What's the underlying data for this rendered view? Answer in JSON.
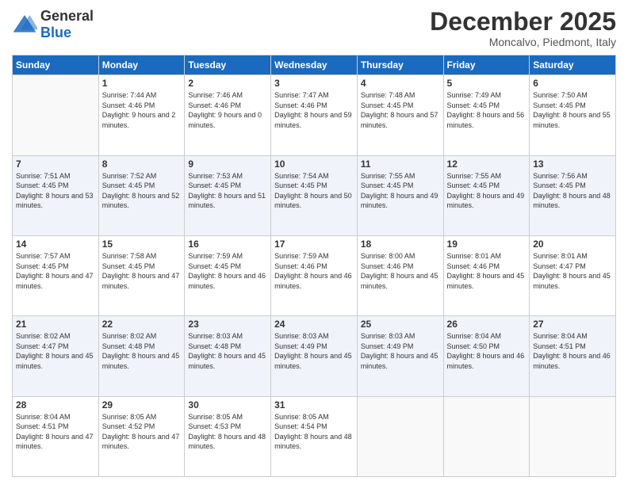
{
  "header": {
    "logo": {
      "general": "General",
      "blue": "Blue"
    },
    "title": "December 2025",
    "subtitle": "Moncalvo, Piedmont, Italy"
  },
  "weekdays": [
    "Sunday",
    "Monday",
    "Tuesday",
    "Wednesday",
    "Thursday",
    "Friday",
    "Saturday"
  ],
  "rows": [
    [
      {
        "day": "",
        "sunrise": "",
        "sunset": "",
        "daylight": ""
      },
      {
        "day": "1",
        "sunrise": "Sunrise: 7:44 AM",
        "sunset": "Sunset: 4:46 PM",
        "daylight": "Daylight: 9 hours and 2 minutes."
      },
      {
        "day": "2",
        "sunrise": "Sunrise: 7:46 AM",
        "sunset": "Sunset: 4:46 PM",
        "daylight": "Daylight: 9 hours and 0 minutes."
      },
      {
        "day": "3",
        "sunrise": "Sunrise: 7:47 AM",
        "sunset": "Sunset: 4:46 PM",
        "daylight": "Daylight: 8 hours and 59 minutes."
      },
      {
        "day": "4",
        "sunrise": "Sunrise: 7:48 AM",
        "sunset": "Sunset: 4:45 PM",
        "daylight": "Daylight: 8 hours and 57 minutes."
      },
      {
        "day": "5",
        "sunrise": "Sunrise: 7:49 AM",
        "sunset": "Sunset: 4:45 PM",
        "daylight": "Daylight: 8 hours and 56 minutes."
      },
      {
        "day": "6",
        "sunrise": "Sunrise: 7:50 AM",
        "sunset": "Sunset: 4:45 PM",
        "daylight": "Daylight: 8 hours and 55 minutes."
      }
    ],
    [
      {
        "day": "7",
        "sunrise": "Sunrise: 7:51 AM",
        "sunset": "Sunset: 4:45 PM",
        "daylight": "Daylight: 8 hours and 53 minutes."
      },
      {
        "day": "8",
        "sunrise": "Sunrise: 7:52 AM",
        "sunset": "Sunset: 4:45 PM",
        "daylight": "Daylight: 8 hours and 52 minutes."
      },
      {
        "day": "9",
        "sunrise": "Sunrise: 7:53 AM",
        "sunset": "Sunset: 4:45 PM",
        "daylight": "Daylight: 8 hours and 51 minutes."
      },
      {
        "day": "10",
        "sunrise": "Sunrise: 7:54 AM",
        "sunset": "Sunset: 4:45 PM",
        "daylight": "Daylight: 8 hours and 50 minutes."
      },
      {
        "day": "11",
        "sunrise": "Sunrise: 7:55 AM",
        "sunset": "Sunset: 4:45 PM",
        "daylight": "Daylight: 8 hours and 49 minutes."
      },
      {
        "day": "12",
        "sunrise": "Sunrise: 7:55 AM",
        "sunset": "Sunset: 4:45 PM",
        "daylight": "Daylight: 8 hours and 49 minutes."
      },
      {
        "day": "13",
        "sunrise": "Sunrise: 7:56 AM",
        "sunset": "Sunset: 4:45 PM",
        "daylight": "Daylight: 8 hours and 48 minutes."
      }
    ],
    [
      {
        "day": "14",
        "sunrise": "Sunrise: 7:57 AM",
        "sunset": "Sunset: 4:45 PM",
        "daylight": "Daylight: 8 hours and 47 minutes."
      },
      {
        "day": "15",
        "sunrise": "Sunrise: 7:58 AM",
        "sunset": "Sunset: 4:45 PM",
        "daylight": "Daylight: 8 hours and 47 minutes."
      },
      {
        "day": "16",
        "sunrise": "Sunrise: 7:59 AM",
        "sunset": "Sunset: 4:45 PM",
        "daylight": "Daylight: 8 hours and 46 minutes."
      },
      {
        "day": "17",
        "sunrise": "Sunrise: 7:59 AM",
        "sunset": "Sunset: 4:46 PM",
        "daylight": "Daylight: 8 hours and 46 minutes."
      },
      {
        "day": "18",
        "sunrise": "Sunrise: 8:00 AM",
        "sunset": "Sunset: 4:46 PM",
        "daylight": "Daylight: 8 hours and 45 minutes."
      },
      {
        "day": "19",
        "sunrise": "Sunrise: 8:01 AM",
        "sunset": "Sunset: 4:46 PM",
        "daylight": "Daylight: 8 hours and 45 minutes."
      },
      {
        "day": "20",
        "sunrise": "Sunrise: 8:01 AM",
        "sunset": "Sunset: 4:47 PM",
        "daylight": "Daylight: 8 hours and 45 minutes."
      }
    ],
    [
      {
        "day": "21",
        "sunrise": "Sunrise: 8:02 AM",
        "sunset": "Sunset: 4:47 PM",
        "daylight": "Daylight: 8 hours and 45 minutes."
      },
      {
        "day": "22",
        "sunrise": "Sunrise: 8:02 AM",
        "sunset": "Sunset: 4:48 PM",
        "daylight": "Daylight: 8 hours and 45 minutes."
      },
      {
        "day": "23",
        "sunrise": "Sunrise: 8:03 AM",
        "sunset": "Sunset: 4:48 PM",
        "daylight": "Daylight: 8 hours and 45 minutes."
      },
      {
        "day": "24",
        "sunrise": "Sunrise: 8:03 AM",
        "sunset": "Sunset: 4:49 PM",
        "daylight": "Daylight: 8 hours and 45 minutes."
      },
      {
        "day": "25",
        "sunrise": "Sunrise: 8:03 AM",
        "sunset": "Sunset: 4:49 PM",
        "daylight": "Daylight: 8 hours and 45 minutes."
      },
      {
        "day": "26",
        "sunrise": "Sunrise: 8:04 AM",
        "sunset": "Sunset: 4:50 PM",
        "daylight": "Daylight: 8 hours and 46 minutes."
      },
      {
        "day": "27",
        "sunrise": "Sunrise: 8:04 AM",
        "sunset": "Sunset: 4:51 PM",
        "daylight": "Daylight: 8 hours and 46 minutes."
      }
    ],
    [
      {
        "day": "28",
        "sunrise": "Sunrise: 8:04 AM",
        "sunset": "Sunset: 4:51 PM",
        "daylight": "Daylight: 8 hours and 47 minutes."
      },
      {
        "day": "29",
        "sunrise": "Sunrise: 8:05 AM",
        "sunset": "Sunset: 4:52 PM",
        "daylight": "Daylight: 8 hours and 47 minutes."
      },
      {
        "day": "30",
        "sunrise": "Sunrise: 8:05 AM",
        "sunset": "Sunset: 4:53 PM",
        "daylight": "Daylight: 8 hours and 48 minutes."
      },
      {
        "day": "31",
        "sunrise": "Sunrise: 8:05 AM",
        "sunset": "Sunset: 4:54 PM",
        "daylight": "Daylight: 8 hours and 48 minutes."
      },
      {
        "day": "",
        "sunrise": "",
        "sunset": "",
        "daylight": ""
      },
      {
        "day": "",
        "sunrise": "",
        "sunset": "",
        "daylight": ""
      },
      {
        "day": "",
        "sunrise": "",
        "sunset": "",
        "daylight": ""
      }
    ]
  ]
}
